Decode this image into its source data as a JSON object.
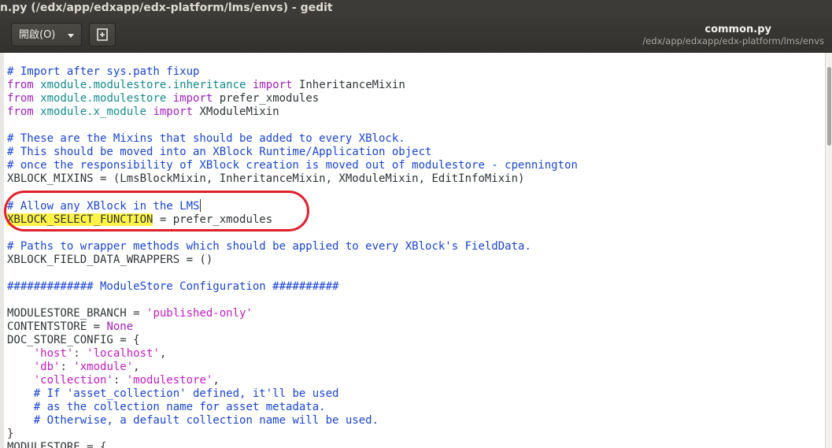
{
  "window": {
    "title": "n.py (/edx/app/edxapp/edx-platform/lms/envs) - gedit"
  },
  "headerbar": {
    "open_label": "開啟(O)",
    "document_title": "common.py",
    "document_path": "/edx/app/edxapp/edx-platform/lms/envs"
  },
  "code": {
    "l1": "# Import after sys.path fixup",
    "l2_kw1": "from",
    "l2_mod": "xmodule.modulestore.inheritance",
    "l2_kw2": "import",
    "l2_name": "InheritanceMixin",
    "l3_kw1": "from",
    "l3_mod": "xmodule.modulestore",
    "l3_kw2": "import",
    "l3_name": "prefer_xmodules",
    "l4_kw1": "from",
    "l4_mod": "xmodule.x_module",
    "l4_kw2": "import",
    "l4_name": "XModuleMixin",
    "l6": "# These are the Mixins that should be added to every XBlock.",
    "l7": "# This should be moved into an XBlock Runtime/Application object",
    "l8": "# once the responsibility of XBlock creation is moved out of modulestore - cpennington",
    "l9": "XBLOCK_MIXINS = (LmsBlockMixin, InheritanceMixin, XModuleMixin, EditInfoMixin)",
    "l11": "# Allow any XBlock in the LMS",
    "l12_var": "XBLOCK_SELECT_FUNCTION",
    "l12_rest": " = prefer_xmodules",
    "l14": "# Paths to wrapper methods which should be applied to every XBlock's FieldData.",
    "l15": "XBLOCK_FIELD_DATA_WRAPPERS = ()",
    "l17": "############# ModuleStore Configuration ##########",
    "l19_var": "MODULESTORE_BRANCH = ",
    "l19_str": "'published-only'",
    "l20_var": "CONTENTSTORE = ",
    "l20_kw": "None",
    "l21": "DOC_STORE_CONFIG = {",
    "l22_key": "'host'",
    "l22_sep": ": ",
    "l22_val": "'localhost'",
    "l22_end": ",",
    "l23_key": "'db'",
    "l23_sep": ": ",
    "l23_val": "'xmodule'",
    "l23_end": ",",
    "l24_key": "'collection'",
    "l24_sep": ": ",
    "l24_val": "'modulestore'",
    "l24_end": ",",
    "l25": "# If 'asset_collection' defined, it'll be used",
    "l26": "# as the collection name for asset metadata.",
    "l27": "# Otherwise, a default collection name will be used.",
    "l28": "}",
    "l29": "MODULESTORE = {"
  }
}
